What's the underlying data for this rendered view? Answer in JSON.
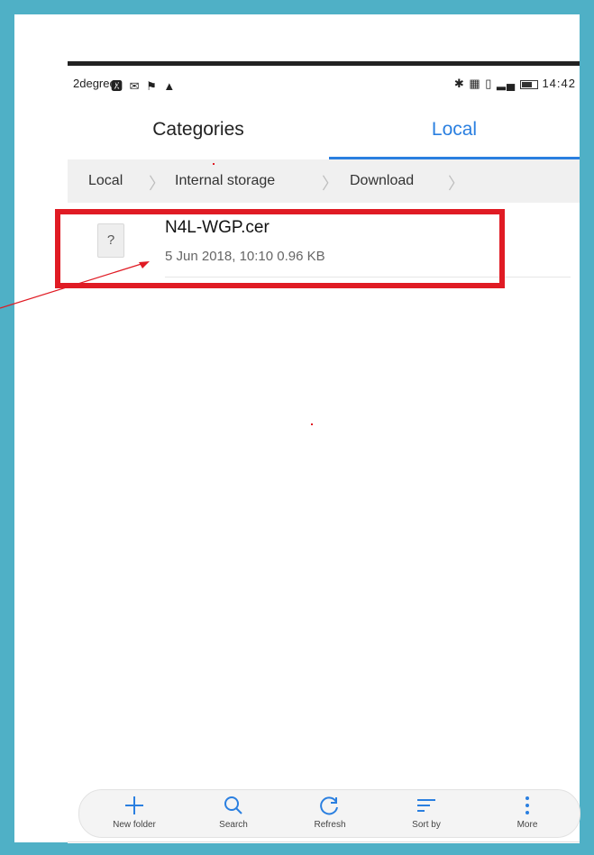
{
  "status_bar": {
    "carrier": "2degrees",
    "icons": "🆇 ✉ ⚑ ▲",
    "right_icons": "✱ ▦ ▯ ▂▄",
    "time": "14:42"
  },
  "tabs": [
    {
      "label": "Categories"
    },
    {
      "label": "Local"
    }
  ],
  "breadcrumb": [
    "Local",
    "Internal storage",
    "Download"
  ],
  "file": {
    "icon_glyph": "?",
    "name": "N4L-WGP.cer",
    "meta": "5 Jun 2018, 10:10 0.96 KB"
  },
  "bottom_bar": [
    {
      "label": "New folder",
      "icon": "plus-icon"
    },
    {
      "label": "Search",
      "icon": "search-icon"
    },
    {
      "label": "Refresh",
      "icon": "refresh-icon"
    },
    {
      "label": "Sort by",
      "icon": "sort-icon"
    },
    {
      "label": "More",
      "icon": "more-icon"
    }
  ],
  "colors": {
    "accent": "#2a7fe0",
    "highlight": "#e01b24",
    "frame": "#4fb0c6"
  }
}
